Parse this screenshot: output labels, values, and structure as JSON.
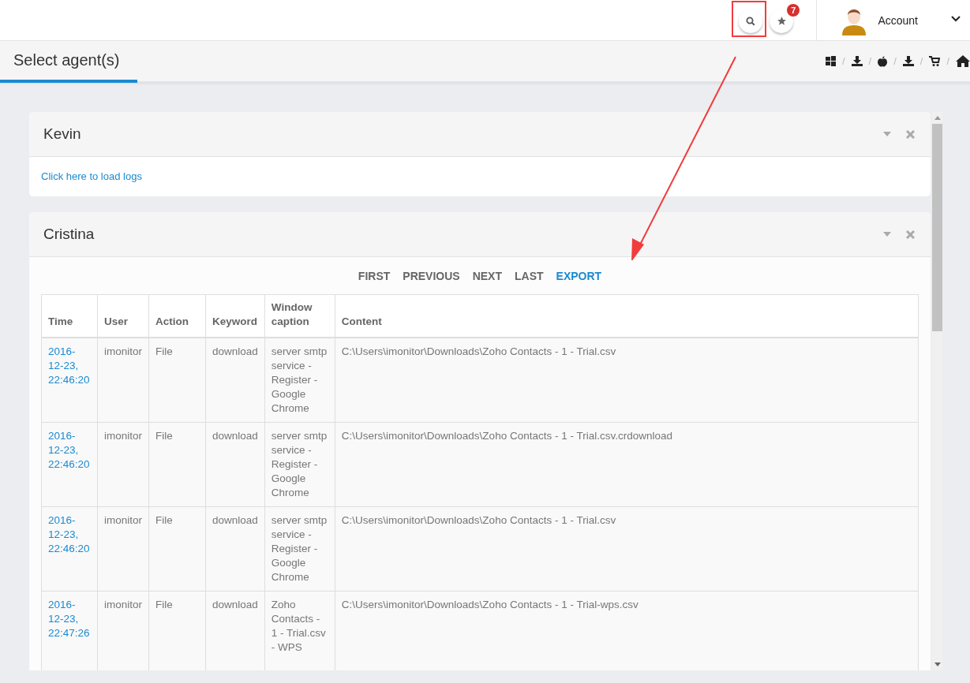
{
  "header": {
    "notification_count": "7",
    "account_label": "Account"
  },
  "page_title": "Select agent(s)",
  "breadcrumbs": [
    {
      "kind": "windows",
      "separator": "/"
    },
    {
      "kind": "download",
      "separator": "/"
    },
    {
      "kind": "apple",
      "separator": "/"
    },
    {
      "kind": "download",
      "separator": "/"
    },
    {
      "kind": "cart",
      "separator": "/"
    },
    {
      "kind": "home"
    }
  ],
  "panels": [
    {
      "name": "Kevin",
      "kind": "link",
      "link": "Click here to load logs"
    },
    {
      "name": "Cristina",
      "kind": "table",
      "pager": [
        {
          "label": "FIRST",
          "kind": "plain"
        },
        {
          "label": "PREVIOUS",
          "kind": "plain"
        },
        {
          "label": "NEXT",
          "kind": "plain"
        },
        {
          "label": "LAST",
          "kind": "plain"
        },
        {
          "label": "EXPORT",
          "kind": "accent"
        }
      ],
      "columns": [
        "Time",
        "User",
        "Action",
        "Keyword",
        "Window caption",
        "Content"
      ],
      "rows": [
        {
          "time": "2016-12-23, 22:46:20",
          "user": "imonitor",
          "action": "File",
          "keyword": "download",
          "caption": "server smtp service - Register - Google Chrome",
          "content": "C:\\Users\\imonitor\\Downloads\\Zoho Contacts - 1 - Trial.csv"
        },
        {
          "time": "2016-12-23, 22:46:20",
          "user": "imonitor",
          "action": "File",
          "keyword": "download",
          "caption": "server smtp service - Register - Google Chrome",
          "content": "C:\\Users\\imonitor\\Downloads\\Zoho Contacts - 1 - Trial.csv.crdownload"
        },
        {
          "time": "2016-12-23, 22:46:20",
          "user": "imonitor",
          "action": "File",
          "keyword": "download",
          "caption": "server smtp service - Register - Google Chrome",
          "content": "C:\\Users\\imonitor\\Downloads\\Zoho Contacts - 1 - Trial.csv"
        },
        {
          "time": "2016-12-23, 22:47:26",
          "user": "imonitor",
          "action": "File",
          "keyword": "download",
          "caption": "Zoho Contacts - 1 - Trial.csv - WPS",
          "content": "C:\\Users\\imonitor\\Downloads\\Zoho Contacts - 1 - Trial-wps.csv"
        }
      ]
    }
  ]
}
